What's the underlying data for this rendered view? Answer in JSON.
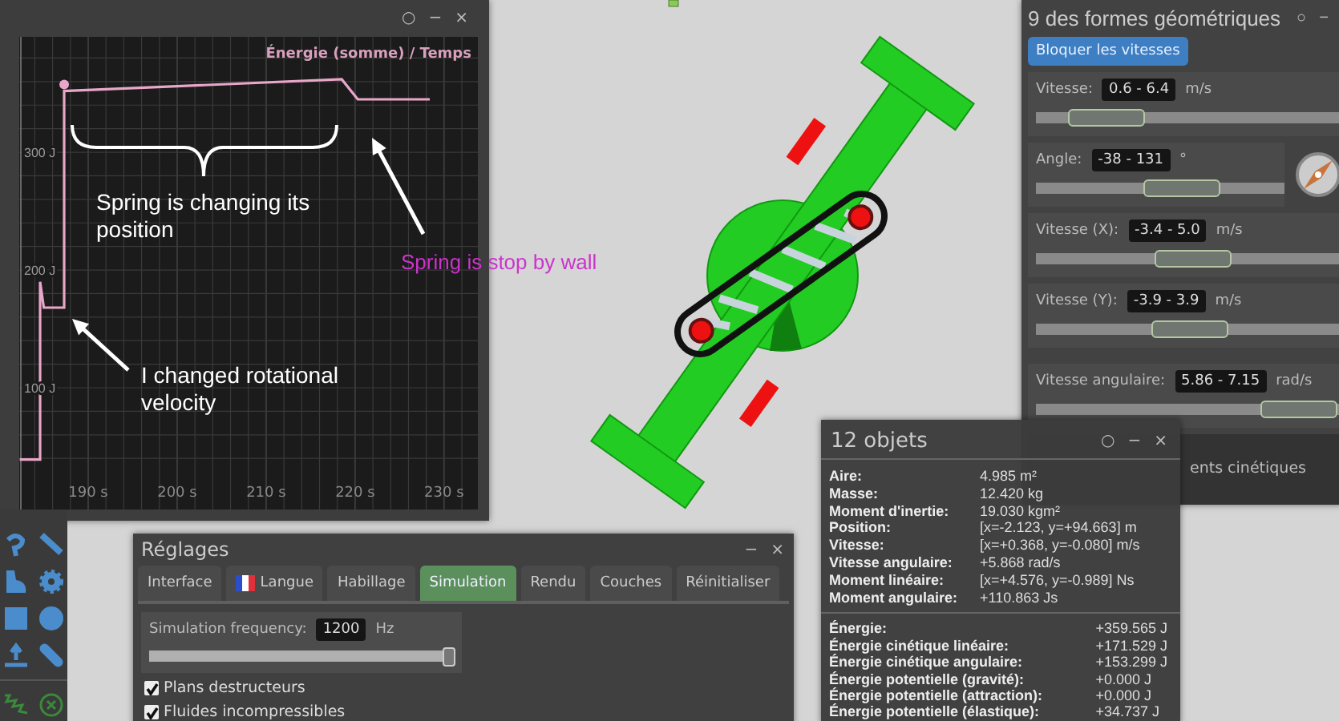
{
  "graph_window": {
    "window_controls": [
      "○",
      "−",
      "×"
    ],
    "chart_data": {
      "type": "line",
      "title": "Énergie (somme) / Temps",
      "grid": true,
      "xlim": [
        182.25,
        233.8
      ],
      "ylim": [
        -3.4,
        398
      ],
      "xticks": [
        {
          "value": 190,
          "label": "190 s"
        },
        {
          "value": 200,
          "label": "200 s"
        },
        {
          "value": 210,
          "label": "210 s"
        },
        {
          "value": 220,
          "label": "220 s"
        },
        {
          "value": 230,
          "label": "230 s"
        }
      ],
      "yticks": [
        {
          "value": 100,
          "label": "100 J"
        },
        {
          "value": 200,
          "label": "200 J"
        },
        {
          "value": 300,
          "label": "300 J"
        }
      ],
      "x": [
        182.3,
        184.6,
        184.6,
        185.0,
        187.3,
        187.3,
        218.5,
        220.3,
        228.4
      ],
      "series": [
        {
          "color": "#e8a6c8",
          "values": [
            39,
            39,
            190,
            168,
            168,
            352,
            362,
            345,
            345
          ]
        }
      ]
    }
  },
  "annotations": [
    {
      "text": "Spring is changing its position",
      "color": "#ffffff"
    },
    {
      "text": "Spring is stop by wall",
      "color": "#cc33cc"
    },
    {
      "text": "I changed rotational velocity",
      "color": "#ffffff"
    }
  ],
  "shapes_window": {
    "title": "9 des formes géométriques",
    "window_controls": [
      "○",
      "−"
    ],
    "lock_button": "Bloquer les vitesses",
    "sliders": [
      {
        "kind": "range",
        "label": "Vitesse:",
        "value": "0.6 - 6.4",
        "unit": "m/s",
        "level": 0.14
      },
      {
        "kind": "angle",
        "label": "Angle:",
        "value": "-38 - 131",
        "unit": "°",
        "level": 0.63
      },
      {
        "kind": "range",
        "label": "Vitesse (X):",
        "value": "-3.4 - 5.0",
        "unit": "m/s",
        "level": 0.52
      },
      {
        "kind": "range",
        "label": "Vitesse (Y):",
        "value": "-3.9 - 3.9",
        "unit": "m/s",
        "level": 0.5
      },
      {
        "kind": "range",
        "label": "Vitesse angulaire:",
        "value": "5.86 - 7.15",
        "unit": "rad/s",
        "level": 0.98
      }
    ],
    "partial_option": "ents cinétiques"
  },
  "objects_window": {
    "title": "12 objets",
    "window_controls": [
      "○",
      "−",
      "×"
    ],
    "properties": [
      {
        "label": "Aire:",
        "value": "4.985 m²"
      },
      {
        "label": "Masse:",
        "value": "12.420 kg"
      },
      {
        "label": "Moment d'inertie:",
        "value": "19.030 kgm²"
      },
      {
        "label": "Position:",
        "value": "[x=-2.123, y=+94.663] m"
      },
      {
        "label": "Vitesse:",
        "value": "[x=+0.368, y=-0.080] m/s"
      },
      {
        "label": "Vitesse angulaire:",
        "value": "+5.868 rad/s"
      },
      {
        "label": "Moment linéaire:",
        "value": "[x=+4.576, y=-0.989] Ns"
      },
      {
        "label": "Moment angulaire:",
        "value": "+110.863 Js"
      }
    ],
    "energies": [
      {
        "label": "Énergie:",
        "value": "+359.565 J"
      },
      {
        "label": "Énergie cinétique linéaire:",
        "value": "+171.529 J"
      },
      {
        "label": "Énergie cinétique angulaire:",
        "value": "+153.299 J"
      },
      {
        "label": "Énergie potentielle (gravité):",
        "value": "+0.000 J"
      },
      {
        "label": "Énergie potentielle (attraction):",
        "value": "+0.000 J"
      },
      {
        "label": "Énergie potentielle (élastique):",
        "value": "+34.737 J"
      }
    ]
  },
  "settings_window": {
    "title": "Réglages",
    "window_controls": [
      "−",
      "×"
    ],
    "tabs": [
      {
        "label": "Interface",
        "selected": false,
        "kind": "text"
      },
      {
        "label": "Langue",
        "selected": false,
        "kind": "flag"
      },
      {
        "label": "Habillage",
        "selected": false,
        "kind": "text"
      },
      {
        "label": "Simulation",
        "selected": true,
        "kind": "text"
      },
      {
        "label": "Rendu",
        "selected": false,
        "kind": "text"
      },
      {
        "label": "Couches",
        "selected": false,
        "kind": "text"
      },
      {
        "label": "Réinitialiser",
        "selected": false,
        "kind": "text"
      }
    ],
    "frequency": {
      "label": "Simulation frequency:",
      "value": "1200",
      "unit": "Hz",
      "level": 1
    },
    "options": [
      {
        "label": "Plans destructeurs",
        "checked": true
      },
      {
        "label": "Fluides incompressibles",
        "checked": true
      }
    ]
  }
}
